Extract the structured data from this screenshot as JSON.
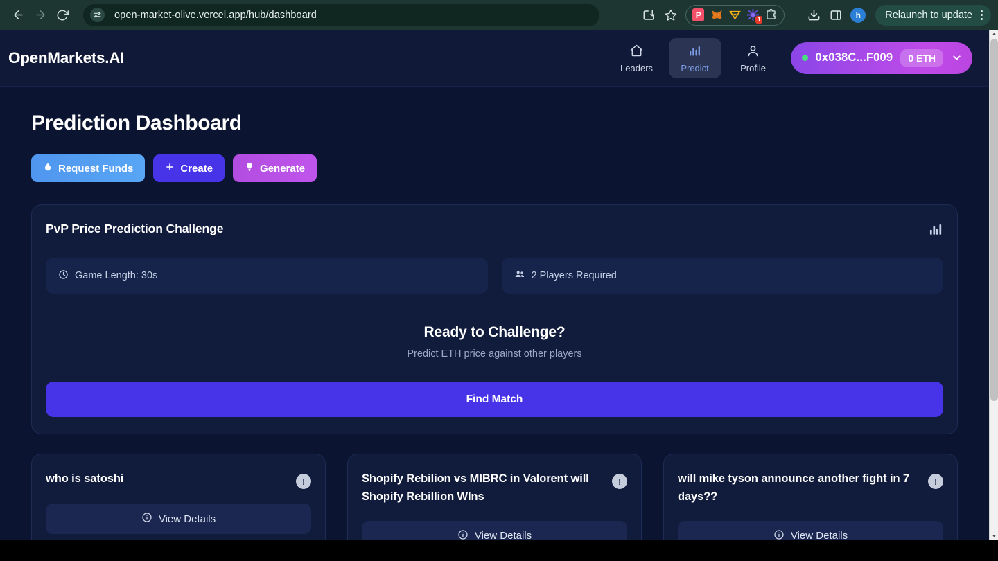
{
  "browser": {
    "back_label": "back",
    "forward_label": "forward",
    "reload_label": "reload",
    "url": "open-market-olive.vercel.app/hub/dashboard",
    "site_settings_icon": "tune-icon",
    "install_icon": "install-app-icon",
    "bookmark_icon": "star-icon",
    "extensions": [
      {
        "name": "pocket-extension-icon",
        "glyph": "P"
      },
      {
        "name": "metamask-extension-icon",
        "glyph": "🦊"
      },
      {
        "name": "phantom-wallet-extension-icon",
        "glyph": "▽"
      },
      {
        "name": "starburst-extension-icon",
        "glyph": "✳",
        "badge": "1"
      },
      {
        "name": "extensions-puzzle-icon",
        "glyph": "⧉"
      }
    ],
    "downloads_icon": "download-icon",
    "side_panel_icon": "side-panel-icon",
    "profile_initial": "h",
    "relaunch_label": "Relaunch to update",
    "menu_icon": "kebab-menu-icon"
  },
  "header": {
    "brand": "OpenMarkets.AI",
    "nav": [
      {
        "label": "Leaders",
        "icon": "home-icon",
        "active": false
      },
      {
        "label": "Predict",
        "icon": "bar-chart-icon",
        "active": true
      },
      {
        "label": "Profile",
        "icon": "person-icon",
        "active": false
      }
    ],
    "wallet": {
      "status_dot_color": "#4ade80",
      "address": "0x038C...F009",
      "balance": "0 ETH",
      "chevron_icon": "chevron-down-icon"
    }
  },
  "main": {
    "title": "Prediction Dashboard",
    "actions": [
      {
        "label": "Request Funds",
        "icon": "droplet-icon",
        "color": "#58a6f5"
      },
      {
        "label": "Create",
        "icon": "plus-icon",
        "color": "#4733e8"
      },
      {
        "label": "Generate",
        "icon": "lightbulb-icon",
        "color": "#c055ec"
      }
    ]
  },
  "pvp": {
    "title": "PvP Price Prediction Challenge",
    "chart_icon": "bar-chart-icon",
    "info": [
      {
        "label": "Game Length: 30s",
        "icon": "clock-icon"
      },
      {
        "label": "2 Players Required",
        "icon": "people-icon"
      }
    ],
    "ready_title": "Ready to Challenge?",
    "ready_subtitle": "Predict ETH price against other players",
    "find_match_label": "Find Match"
  },
  "markets": [
    {
      "title": "who is satoshi",
      "badge": "!",
      "view_details_label": "View Details",
      "view_details_icon": "info-icon"
    },
    {
      "title": "Shopify Rebilion vs MIBRC in Valorent will Shopify Rebillion WIns",
      "badge": "!",
      "view_details_label": "View Details",
      "view_details_icon": "info-icon"
    },
    {
      "title": "will mike tyson announce another fight in 7 days??",
      "badge": "!",
      "view_details_label": "View Details",
      "view_details_icon": "info-icon"
    }
  ],
  "scrollbar": {
    "up_icon": "scroll-up-arrow-icon",
    "down_icon": "scroll-down-arrow-icon"
  }
}
